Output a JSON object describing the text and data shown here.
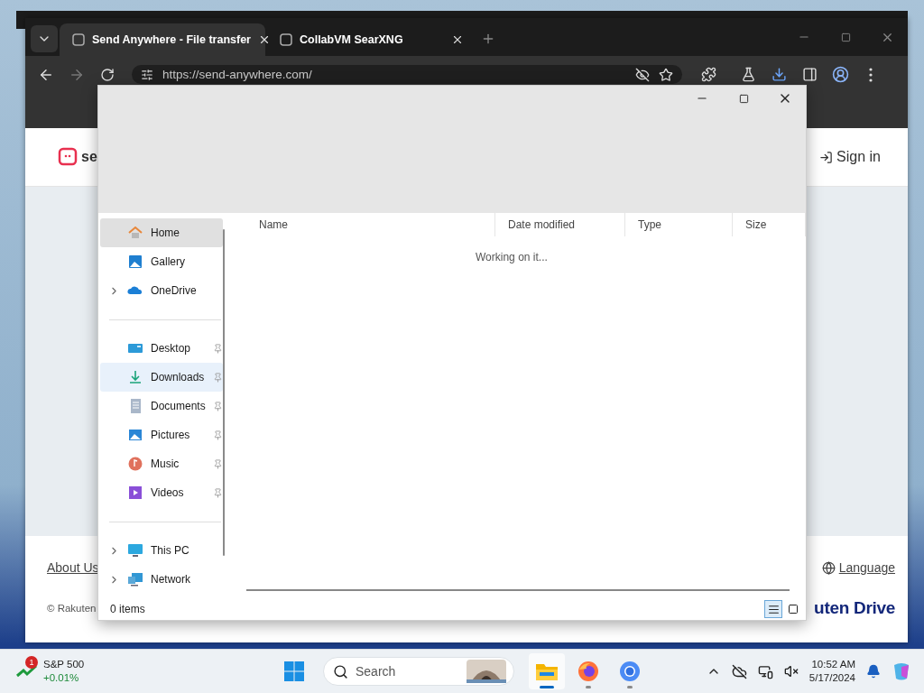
{
  "browser": {
    "tabs": [
      {
        "title": "Send Anywhere - File transfer",
        "selected": true
      },
      {
        "title": "CollabVM SearXNG",
        "selected": false
      }
    ],
    "url": "https://send-anywhere.com/"
  },
  "web_page": {
    "logo_text": "se",
    "sign_in": "Sign in",
    "about": "About Us",
    "copyright": "© Rakuten",
    "language": "Language",
    "brand": "uten Drive"
  },
  "explorer": {
    "sidebar": {
      "groups": [
        [
          {
            "label": "Home",
            "kind": "home",
            "expandable": false,
            "pinned": false,
            "selected": true,
            "hovered": false
          },
          {
            "label": "Gallery",
            "kind": "gallery",
            "expandable": false,
            "pinned": false,
            "selected": false,
            "hovered": false
          },
          {
            "label": "OneDrive",
            "kind": "cloud",
            "expandable": true,
            "pinned": false,
            "selected": false,
            "hovered": false
          }
        ],
        [
          {
            "label": "Desktop",
            "kind": "desktop",
            "expandable": false,
            "pinned": true,
            "selected": false,
            "hovered": false
          },
          {
            "label": "Downloads",
            "kind": "download",
            "expandable": false,
            "pinned": true,
            "selected": false,
            "hovered": true
          },
          {
            "label": "Documents",
            "kind": "document",
            "expandable": false,
            "pinned": true,
            "selected": false,
            "hovered": false
          },
          {
            "label": "Pictures",
            "kind": "pictures",
            "expandable": false,
            "pinned": true,
            "selected": false,
            "hovered": false
          },
          {
            "label": "Music",
            "kind": "music",
            "expandable": false,
            "pinned": true,
            "selected": false,
            "hovered": false
          },
          {
            "label": "Videos",
            "kind": "videos",
            "expandable": false,
            "pinned": true,
            "selected": false,
            "hovered": false
          }
        ],
        [
          {
            "label": "This PC",
            "kind": "pc",
            "expandable": true,
            "pinned": false,
            "selected": false,
            "hovered": false
          },
          {
            "label": "Network",
            "kind": "network",
            "expandable": true,
            "pinned": false,
            "selected": false,
            "hovered": false
          }
        ]
      ]
    },
    "columns": [
      "Name",
      "Date modified",
      "Type",
      "Size"
    ],
    "message": "Working on it...",
    "status_bar": "0 items",
    "view_buttons": [
      {
        "kind": "details",
        "selected": true
      },
      {
        "kind": "tiles",
        "selected": false
      }
    ]
  },
  "taskbar": {
    "widget": {
      "name": "S&P 500",
      "change": "+0.01%",
      "badge": "1"
    },
    "search": {
      "placeholder": "Search"
    },
    "apps": [
      {
        "kind": "explorer",
        "active": true
      },
      {
        "kind": "firefox",
        "active": false
      },
      {
        "kind": "chrome",
        "active": false
      }
    ],
    "clock": {
      "time": "10:52 AM",
      "date": "5/17/2024"
    }
  }
}
